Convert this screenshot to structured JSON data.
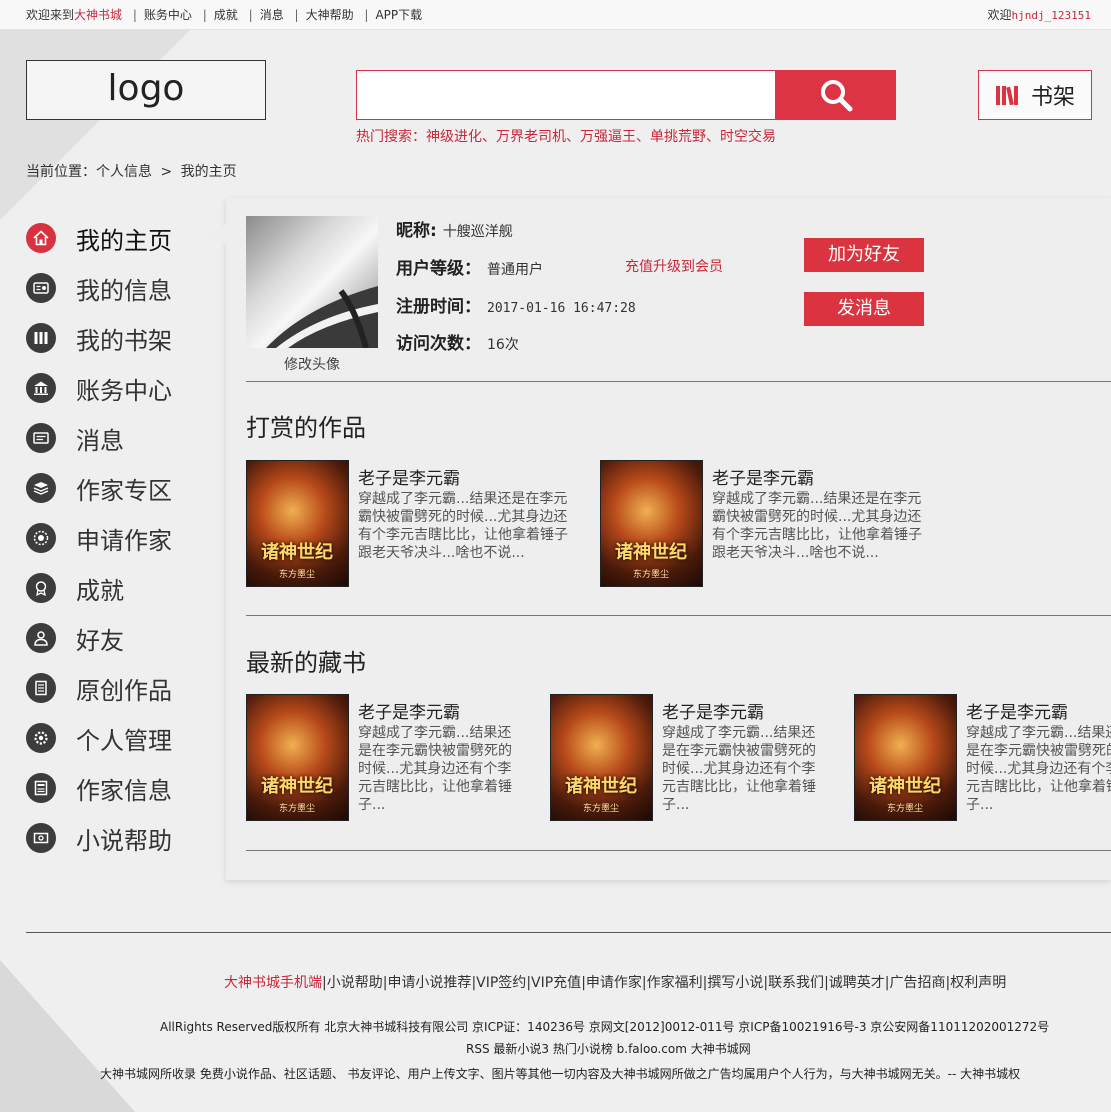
{
  "topbar": {
    "welcome_prefix": "欢迎来到",
    "site_name": "大神书城",
    "links": [
      "账务中心",
      "成就",
      "消息",
      "大神帮助",
      "APP下载"
    ],
    "greet": "欢迎",
    "username": "hjndj_123151"
  },
  "header": {
    "logo": "logo",
    "search_value": "",
    "hot_label": "热门搜索：",
    "hot_items": "神级进化、万界老司机、万强逼王、单挑荒野、时空交易",
    "shelf_label": "书架"
  },
  "breadcrumb": {
    "label": "当前位置：",
    "parent": "个人信息",
    "separator": ">",
    "current": "我的主页"
  },
  "sidebar": {
    "items": [
      {
        "label": "我的主页",
        "icon": "home-icon"
      },
      {
        "label": "我的信息",
        "icon": "id-card-icon"
      },
      {
        "label": "我的书架",
        "icon": "books-icon"
      },
      {
        "label": "账务中心",
        "icon": "bank-icon"
      },
      {
        "label": "消息",
        "icon": "message-icon"
      },
      {
        "label": "作家专区",
        "icon": "layers-icon"
      },
      {
        "label": "申请作家",
        "icon": "badge-icon"
      },
      {
        "label": "成就",
        "icon": "medal-icon"
      },
      {
        "label": "好友",
        "icon": "user-icon"
      },
      {
        "label": "原创作品",
        "icon": "document-icon"
      },
      {
        "label": "个人管理",
        "icon": "gear-icon"
      },
      {
        "label": "作家信息",
        "icon": "list-icon"
      },
      {
        "label": "小说帮助",
        "icon": "help-icon"
      }
    ]
  },
  "profile": {
    "change_avatar": "修改头像",
    "nickname_label": "昵称:",
    "nickname": "十艘巡洋舰",
    "level_label": "用户等级：",
    "level": "普通用户",
    "upgrade_link": "充值升级到会员",
    "reg_label": "注册时间：",
    "reg_time": "2017-01-16  16:47:28",
    "visits_label": "访问次数：",
    "visits": "16次",
    "add_friend": "加为好友",
    "send_message": "发消息"
  },
  "rewarded": {
    "title": "打赏的作品",
    "books": [
      {
        "title": "老子是李元霸",
        "desc": "穿越成了李元霸...结果还是在李元霸快被雷劈死的时候...尤其身边还有个李元吉瞎比比，让他拿着锤子跟老天爷决斗...啥也不说..."
      },
      {
        "title": "老子是李元霸",
        "desc": "穿越成了李元霸...结果还是在李元霸快被雷劈死的时候...尤其身边还有个李元吉瞎比比，让他拿着锤子跟老天爷决斗...啥也不说..."
      }
    ]
  },
  "latest": {
    "title": "最新的藏书",
    "books": [
      {
        "title": "老子是李元霸",
        "desc": "穿越成了李元霸...结果还是在李元霸快被雷劈死的时候...尤其身边还有个李元吉瞎比比，让他拿着锤子..."
      },
      {
        "title": "老子是李元霸",
        "desc": "穿越成了李元霸...结果还是在李元霸快被雷劈死的时候...尤其身边还有个李元吉瞎比比，让他拿着锤子..."
      },
      {
        "title": "老子是李元霸",
        "desc": "穿越成了李元霸...结果还是在李元霸快被雷劈死的时候...尤其身边还有个李元吉瞎比比，让他拿着锤子..."
      }
    ]
  },
  "cover": {
    "title": "诸神世纪",
    "author": "东方墨尘"
  },
  "footer": {
    "links": [
      "大神书城手机端",
      "小说帮助",
      "申请小说推荐",
      "VIP签约",
      "VIP充值",
      "申请作家",
      "作家福利",
      "撰写小说",
      "联系我们",
      "诚聘英才",
      "广告招商",
      "权利声明"
    ],
    "line1": "AllRights Reserved版权所有 北京大神书城科技有限公司 京ICP证：140236号 京网文[2012]0012-011号 京ICP备10021916号-3 京公安网备11011202001272号",
    "line2": "RSS 最新小说3 热门小说榜 b.faloo.com 大神书城网",
    "line3": "大神书城网所收录 免费小说作品、社区话题、 书友评论、用户上传文字、图片等其他一切内容及大神书城网所做之广告均属用户个人行为，与大神书城网无关。-- 大神书城权"
  },
  "colors": {
    "accent": "#d9343f",
    "dark_icon": "#3c3c3c"
  }
}
